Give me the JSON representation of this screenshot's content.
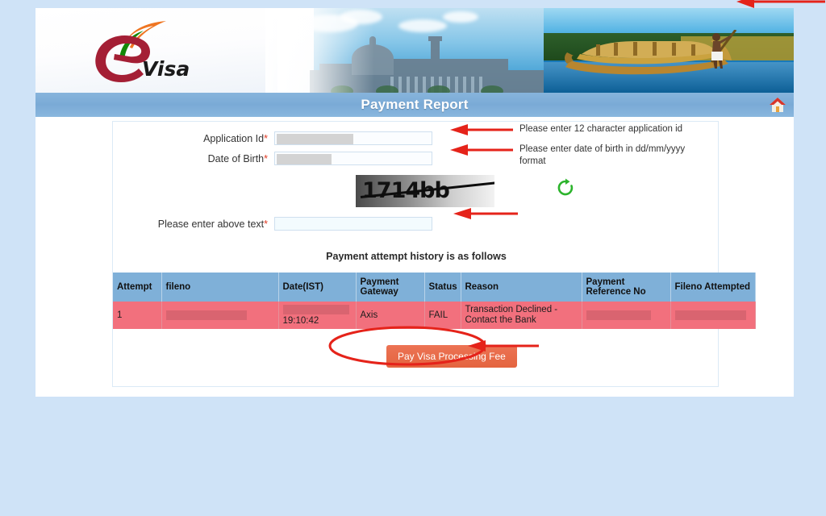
{
  "page": {
    "title": "Payment Report"
  },
  "header": {
    "logo_alt": "eVisa",
    "logo_text": "Visa",
    "home_icon": "home-icon"
  },
  "form": {
    "fields": [
      {
        "label": "Application Id",
        "required": "*",
        "value": "",
        "redacted": true
      },
      {
        "label": "Date of Birth",
        "required": "*",
        "value": "",
        "redacted": true
      },
      {
        "label": "Please enter above text",
        "required": "*",
        "value": "",
        "redacted": false
      }
    ],
    "captcha": {
      "text": "1714bb",
      "refresh_icon": "refresh-icon"
    }
  },
  "annotations": [
    {
      "text": "Please enter 12 character application id"
    },
    {
      "text": "Please enter date of birth in dd/mm/yyyy format"
    }
  ],
  "history": {
    "heading": "Payment attempt history is as follows",
    "columns": [
      "Attempt",
      "fileno",
      "Date(IST)",
      "Payment Gateway",
      "Status",
      "Reason",
      "Payment Reference No",
      "Fileno Attempted"
    ],
    "rows": [
      {
        "attempt": "1",
        "fileno": "",
        "date": "19:10:42",
        "gateway": "Axis",
        "status": "FAIL",
        "reason": "Transaction Declined - Contact the Bank",
        "reference_no": "",
        "fileno_attempted": ""
      }
    ]
  },
  "actions": {
    "pay_button": "Pay Visa Processing Fee"
  },
  "colors": {
    "page_background": "#cfe3f7",
    "title_bar": "#7aaad6",
    "table_header": "#7fb0d8",
    "table_row_fail": "#f2707d",
    "pay_button": "#e4643f",
    "annotation_red": "#e5231a",
    "required_star": "#e03b24",
    "refresh_green": "#2cb42c"
  }
}
